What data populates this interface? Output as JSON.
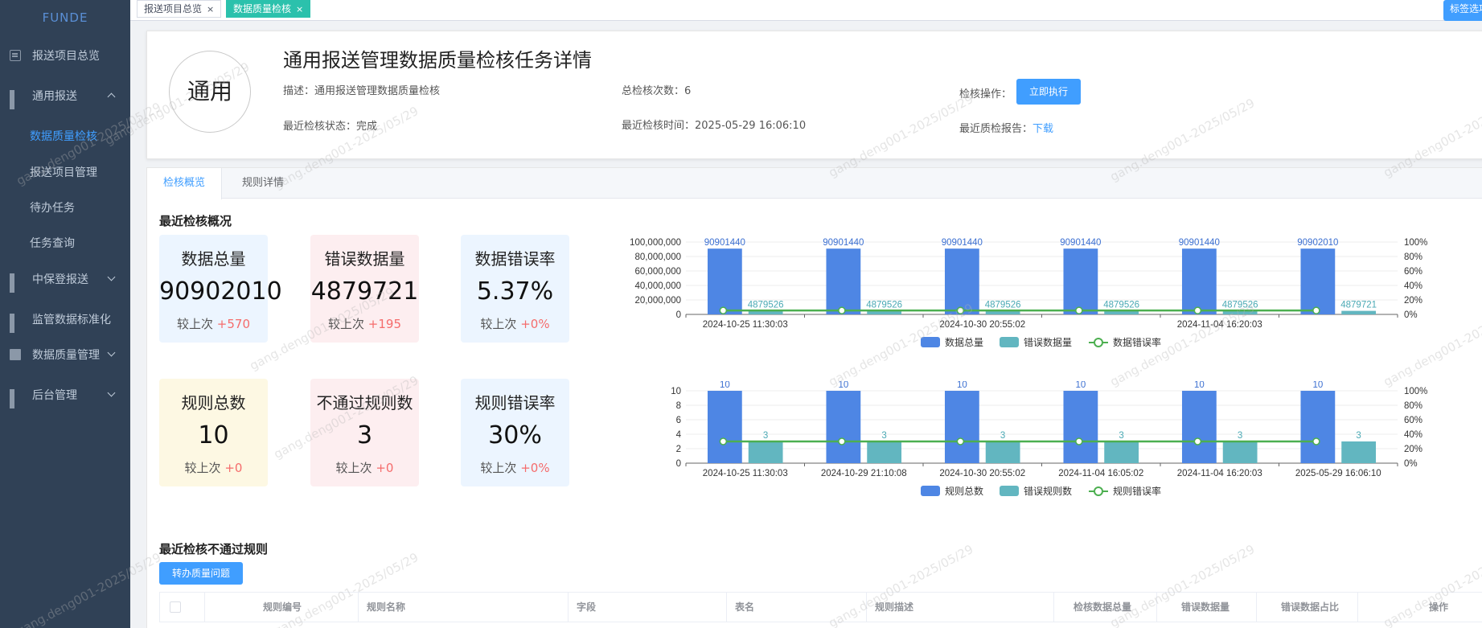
{
  "app": {
    "logo": "FUNDE"
  },
  "sidebar": {
    "items": [
      {
        "label": "报送项目总览"
      },
      {
        "label": "通用报送"
      },
      {
        "label": "数据质量检核"
      },
      {
        "label": "报送项目管理"
      },
      {
        "label": "待办任务"
      },
      {
        "label": "任务查询"
      },
      {
        "label": "中保登报送"
      },
      {
        "label": "监管数据标准化"
      },
      {
        "label": "数据质量管理"
      },
      {
        "label": "后台管理"
      }
    ]
  },
  "tabs": [
    {
      "label": "报送项目总览",
      "close": "×"
    },
    {
      "label": "数据质量检核",
      "close": "×"
    }
  ],
  "tag_button": "标签选项",
  "header": {
    "avatar": "通用",
    "title": "通用报送管理数据质量检核任务详情",
    "desc_label": "描述：",
    "desc_value": "通用报送管理数据质量检核",
    "total_checks_label": "总检核次数：",
    "total_checks_value": "6",
    "action_label": "检核操作：",
    "run_button": "立即执行",
    "status_label": "最近检核状态：",
    "status_value": "完成",
    "time_label": "最近检核时间：",
    "time_value": "2025-05-29 16:06:10",
    "report_label": "最近质检报告：",
    "report_link": "下载"
  },
  "content_tabs": [
    {
      "label": "检核概览"
    },
    {
      "label": "规则详情"
    }
  ],
  "overview": {
    "title": "最近检核概况",
    "change_prefix": "较上次",
    "kpis": [
      {
        "label": "数据总量",
        "value": "90902010",
        "change": "+570"
      },
      {
        "label": "错误数据量",
        "value": "4879721",
        "change": "+195"
      },
      {
        "label": "数据错误率",
        "value": "5.37%",
        "change": "+0%"
      },
      {
        "label": "规则总数",
        "value": "10",
        "change": "+0"
      },
      {
        "label": "不通过规则数",
        "value": "3",
        "change": "+0"
      },
      {
        "label": "规则错误率",
        "value": "30%",
        "change": "+0%"
      }
    ]
  },
  "failed_rules": {
    "title": "最近检核不通过规则",
    "transfer_button": "转办质量问题",
    "columns": [
      "规则编号",
      "规则名称",
      "字段",
      "表名",
      "规则描述",
      "检核数据总量",
      "错误数据量",
      "错误数据占比",
      "操作"
    ]
  },
  "watermark": "gang.deng001-2025/05/29",
  "chart_data": [
    {
      "type": "bar",
      "categories": [
        "2024-10-25 11:30:03",
        "2024-10-29 21:10:08",
        "2024-10-30 20:55:02",
        "2024-11-04 16:05:02",
        "2024-11-04 16:20:03",
        "2025-05-29 16:06:10"
      ],
      "tick_labels_shown": [
        "2024-10-25 11:30:03",
        "2024-10-30 20:55:02",
        "2024-11-04 16:20:03"
      ],
      "series": [
        {
          "name": "数据总量",
          "type": "bar",
          "values": [
            90901440,
            90901440,
            90901440,
            90901440,
            90901440,
            90902010
          ],
          "color": "#4e86e4"
        },
        {
          "name": "错误数据量",
          "type": "bar",
          "values": [
            4879526,
            4879526,
            4879526,
            4879526,
            4879526,
            4879721
          ],
          "color": "#62b6c0"
        },
        {
          "name": "数据错误率",
          "type": "line",
          "axis": "right",
          "values": [
            5.37,
            5.37,
            5.37,
            5.37,
            5.37,
            5.37
          ],
          "color": "#4caf50"
        }
      ],
      "y_left": {
        "min": 0,
        "max": 100000000,
        "ticks": [
          "0",
          "20,000,000",
          "40,000,000",
          "60,000,000",
          "80,000,000",
          "100,000,000"
        ]
      },
      "y_right": {
        "min": 0,
        "max": 100,
        "ticks": [
          "0%",
          "20%",
          "40%",
          "60%",
          "80%",
          "100%"
        ]
      },
      "legend": "bottom"
    },
    {
      "type": "bar",
      "categories": [
        "2024-10-25 11:30:03",
        "2024-10-29 21:10:08",
        "2024-10-30 20:55:02",
        "2024-11-04 16:05:02",
        "2024-11-04 16:20:03",
        "2025-05-29 16:06:10"
      ],
      "tick_labels_shown": [
        "2024-10-25 11:30:03",
        "2024-10-29 21:10:08",
        "2024-10-30 20:55:02",
        "2024-11-04 16:05:02",
        "2024-11-04 16:20:03",
        "2025-05-29 16:06:10"
      ],
      "series": [
        {
          "name": "规则总数",
          "type": "bar",
          "values": [
            10,
            10,
            10,
            10,
            10,
            10
          ],
          "color": "#4e86e4"
        },
        {
          "name": "错误规则数",
          "type": "bar",
          "values": [
            3,
            3,
            3,
            3,
            3,
            3
          ],
          "color": "#62b6c0"
        },
        {
          "name": "规则错误率",
          "type": "line",
          "axis": "right",
          "values": [
            30,
            30,
            30,
            30,
            30,
            30
          ],
          "color": "#4caf50"
        }
      ],
      "y_left": {
        "min": 0,
        "max": 10,
        "ticks": [
          "0",
          "2",
          "4",
          "6",
          "8",
          "10"
        ]
      },
      "y_right": {
        "min": 0,
        "max": 100,
        "ticks": [
          "0%",
          "20%",
          "40%",
          "60%",
          "80%",
          "100%"
        ]
      },
      "legend": "bottom"
    }
  ]
}
